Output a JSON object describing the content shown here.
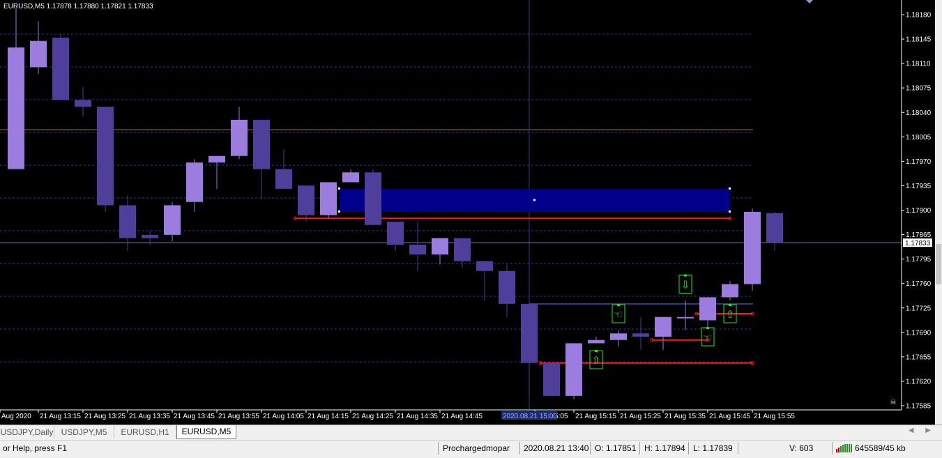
{
  "chart": {
    "symbol_line": "EURUSD,M5  1.17878 1.17880 1.17821 1.17833",
    "price_axis_labels": [
      "1.18180",
      "1.18145",
      "1.18110",
      "1.18075",
      "1.18040",
      "1.18005",
      "1.17970",
      "1.17935",
      "1.17900",
      "1.17865",
      "1.17795",
      "1.17760",
      "1.17725",
      "1.17690",
      "1.17655",
      "1.17620",
      "1.17585"
    ],
    "current_price_label": "1.17833",
    "time_axis_labels": [
      "Aug 2020",
      "21 Aug 13:15",
      "21 Aug 13:25",
      "21 Aug 13:35",
      "21 Aug 13:45",
      "21 Aug 13:55",
      "21 Aug 14:05",
      "21 Aug 14:15",
      "21 Aug 14:25",
      "21 Aug 14:35",
      "21 Aug 14:45",
      "Aug 15:05",
      "21 Aug 15:15",
      "21 Aug 15:25",
      "21 Aug 15:35",
      "21 Aug 15:45",
      "21 Aug 15:55"
    ],
    "crosshair_time_label": "2020.08.21 15:00",
    "colors": {
      "background": "#000000",
      "bull_candle": "#9d7ce0",
      "bear_candle": "#4f3f9a",
      "grid": "#2b3f8a",
      "zone": "#00008b",
      "level_red": "#ff1a1a",
      "signal_box": "#2ee02e",
      "level_orange": "#a06a3a",
      "axis_text": "#ffffff"
    }
  },
  "chart_data": {
    "type": "candlestick",
    "symbol": "EURUSD",
    "timeframe": "M5",
    "ylim": [
      1.17575,
      1.18195
    ],
    "candles": [
      {
        "time": "13:05",
        "open": 1.17945,
        "high": 1.1819,
        "low": 1.181,
        "close": 1.1813
      },
      {
        "time": "13:10",
        "open": 1.181,
        "high": 1.1817,
        "low": 1.1809,
        "close": 1.1814
      },
      {
        "time": "13:15",
        "open": 1.18145,
        "high": 1.1815,
        "low": 1.1805,
        "close": 1.1805
      },
      {
        "time": "13:20",
        "open": 1.1805,
        "high": 1.1807,
        "low": 1.18025,
        "close": 1.1804
      },
      {
        "time": "13:25",
        "open": 1.1804,
        "high": 1.1804,
        "low": 1.1788,
        "close": 1.1789
      },
      {
        "time": "13:30",
        "open": 1.1789,
        "high": 1.17905,
        "low": 1.1782,
        "close": 1.1784
      },
      {
        "time": "13:35",
        "open": 1.17845,
        "high": 1.1785,
        "low": 1.1783,
        "close": 1.1784
      },
      {
        "time": "13:40",
        "open": 1.17845,
        "high": 1.17895,
        "low": 1.17835,
        "close": 1.1789
      },
      {
        "time": "13:45",
        "open": 1.17895,
        "high": 1.1796,
        "low": 1.1788,
        "close": 1.17955
      },
      {
        "time": "13:50",
        "open": 1.17955,
        "high": 1.17965,
        "low": 1.17915,
        "close": 1.17965
      },
      {
        "time": "13:55",
        "open": 1.17965,
        "high": 1.1804,
        "low": 1.1796,
        "close": 1.1802
      },
      {
        "time": "14:00",
        "open": 1.1802,
        "high": 1.1802,
        "low": 1.179,
        "close": 1.17945
      },
      {
        "time": "14:05",
        "open": 1.17945,
        "high": 1.17975,
        "low": 1.17915,
        "close": 1.17915
      },
      {
        "time": "14:10",
        "open": 1.1792,
        "high": 1.1792,
        "low": 1.17865,
        "close": 1.17875
      },
      {
        "time": "14:15",
        "open": 1.17875,
        "high": 1.1792,
        "low": 1.1787,
        "close": 1.17925
      },
      {
        "time": "14:20",
        "open": 1.17925,
        "high": 1.17945,
        "low": 1.17925,
        "close": 1.1794
      },
      {
        "time": "14:25",
        "open": 1.1794,
        "high": 1.17945,
        "low": 1.1786,
        "close": 1.1786
      },
      {
        "time": "14:30",
        "open": 1.17865,
        "high": 1.17865,
        "low": 1.1782,
        "close": 1.1783
      },
      {
        "time": "14:35",
        "open": 1.1783,
        "high": 1.17865,
        "low": 1.1779,
        "close": 1.17815
      },
      {
        "time": "14:40",
        "open": 1.17815,
        "high": 1.1784,
        "low": 1.178,
        "close": 1.1784
      },
      {
        "time": "14:45",
        "open": 1.1784,
        "high": 1.1784,
        "low": 1.17795,
        "close": 1.17805
      },
      {
        "time": "14:50",
        "open": 1.17805,
        "high": 1.17805,
        "low": 1.17745,
        "close": 1.1779
      },
      {
        "time": "14:55",
        "open": 1.1779,
        "high": 1.178,
        "low": 1.1772,
        "close": 1.1774
      },
      {
        "time": "15:00",
        "open": 1.1774,
        "high": 1.1774,
        "low": 1.176,
        "close": 1.1765
      },
      {
        "time": "15:05",
        "open": 1.1765,
        "high": 1.1765,
        "low": 1.176,
        "close": 1.176
      },
      {
        "time": "15:10",
        "open": 1.176,
        "high": 1.1768,
        "low": 1.17595,
        "close": 1.1768
      },
      {
        "time": "15:15",
        "open": 1.1768,
        "high": 1.1769,
        "low": 1.1768,
        "close": 1.17685
      },
      {
        "time": "15:20",
        "open": 1.17685,
        "high": 1.177,
        "low": 1.17675,
        "close": 1.17695
      },
      {
        "time": "15:25",
        "open": 1.17695,
        "high": 1.1772,
        "low": 1.1767,
        "close": 1.1769
      },
      {
        "time": "15:30",
        "open": 1.1769,
        "high": 1.1772,
        "low": 1.1767,
        "close": 1.1772
      },
      {
        "time": "15:35",
        "open": 1.1772,
        "high": 1.17745,
        "low": 1.177,
        "close": 1.1772
      },
      {
        "time": "15:40",
        "open": 1.17715,
        "high": 1.1775,
        "low": 1.17705,
        "close": 1.1775
      },
      {
        "time": "15:45",
        "open": 1.1775,
        "high": 1.17775,
        "low": 1.17745,
        "close": 1.1777
      },
      {
        "time": "15:50",
        "open": 1.1777,
        "high": 1.17885,
        "low": 1.1776,
        "close": 1.1788
      },
      {
        "time": "15:55",
        "open": 1.17878,
        "high": 1.1788,
        "low": 1.17821,
        "close": 1.17833
      }
    ],
    "zone": {
      "price_top": 1.17915,
      "price_bottom": 1.1788,
      "time_from": "14:20",
      "time_to": "15:45"
    },
    "levels_red": [
      {
        "price": 1.1787,
        "time_from": "14:10",
        "time_to": "15:45"
      },
      {
        "price": 1.17725,
        "time_from": "15:40",
        "time_to": "15:50"
      },
      {
        "price": 1.17685,
        "time_from": "15:30",
        "time_to": "15:40"
      },
      {
        "price": 1.1765,
        "time_from": "15:05",
        "time_to": "15:50"
      }
    ],
    "level_blue": {
      "price": 1.1774,
      "time_from": "15:00",
      "time_to": "16:00"
    },
    "level_orange": 1.18005,
    "crosshair_time": "15:00",
    "current_price": 1.17833,
    "signals": [
      {
        "time": "15:15",
        "price": 1.17655,
        "type": "up"
      },
      {
        "time": "15:20",
        "price": 1.17725,
        "type": "hand"
      },
      {
        "time": "15:35",
        "price": 1.1777,
        "type": "down"
      },
      {
        "time": "15:40",
        "price": 1.1769,
        "type": "hand"
      },
      {
        "time": "15:45",
        "price": 1.17725,
        "type": "up"
      }
    ]
  },
  "tabs": [
    {
      "label": "USDJPY,Daily",
      "active": false
    },
    {
      "label": "USDJPY,M5",
      "active": false
    },
    {
      "label": "EURUSD,H1",
      "active": false
    },
    {
      "label": "EURUSD,M5",
      "active": true
    }
  ],
  "status": {
    "help": "or Help, press F1",
    "profile": "Prochargedmopar",
    "datetime": "2020.08.21 13:40",
    "open": "O: 1.17851",
    "high": "H: 1.17894",
    "low": "L: 1.17839",
    "volume": "V: 603",
    "traffic": "645589/45 kb"
  }
}
